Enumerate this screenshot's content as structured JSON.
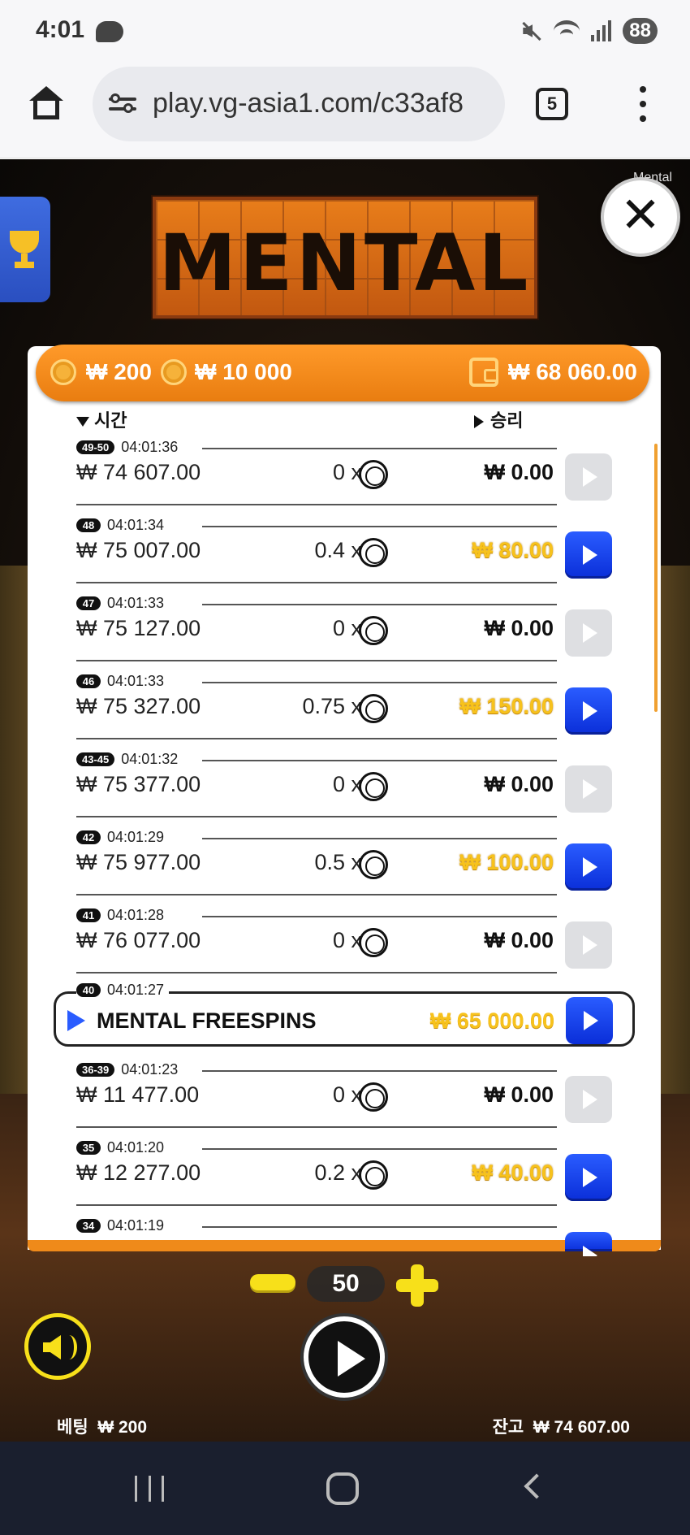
{
  "status_bar": {
    "time": "4:01",
    "battery": "88"
  },
  "browser": {
    "url": "play.vg-asia1.com/c33af8",
    "tab_count": "5"
  },
  "game": {
    "logo_text": "MENTAL",
    "title_label": "Mental",
    "header": {
      "min_bet": "₩ 200",
      "max_bet": "₩ 10 000",
      "wallet": "₩ 68 060.00"
    },
    "columns": {
      "time": "시간",
      "win": "승리"
    },
    "rows": [
      {
        "round": "49-50",
        "time": "04:01:36",
        "amount": "₩ 74 607.00",
        "mult": "0 x",
        "win": "₩ 0.00",
        "win_style": "dark",
        "replay": "inactive"
      },
      {
        "round": "48",
        "time": "04:01:34",
        "amount": "₩ 75 007.00",
        "mult": "0.4 x",
        "win": "₩ 80.00",
        "win_style": "gold",
        "replay": "active"
      },
      {
        "round": "47",
        "time": "04:01:33",
        "amount": "₩ 75 127.00",
        "mult": "0 x",
        "win": "₩ 0.00",
        "win_style": "dark",
        "replay": "inactive"
      },
      {
        "round": "46",
        "time": "04:01:33",
        "amount": "₩ 75 327.00",
        "mult": "0.75 x",
        "win": "₩ 150.00",
        "win_style": "gold",
        "replay": "active"
      },
      {
        "round": "43-45",
        "time": "04:01:32",
        "amount": "₩ 75 377.00",
        "mult": "0 x",
        "win": "₩ 0.00",
        "win_style": "dark",
        "replay": "inactive"
      },
      {
        "round": "42",
        "time": "04:01:29",
        "amount": "₩ 75 977.00",
        "mult": "0.5 x",
        "win": "₩ 100.00",
        "win_style": "gold",
        "replay": "active"
      },
      {
        "round": "41",
        "time": "04:01:28",
        "amount": "₩ 76 077.00",
        "mult": "0 x",
        "win": "₩ 0.00",
        "win_style": "dark",
        "replay": "inactive"
      }
    ],
    "freespins": {
      "round": "40",
      "time": "04:01:27",
      "label": "MENTAL FREESPINS",
      "win": "₩ 65 000.00"
    },
    "rows_after": [
      {
        "round": "36-39",
        "time": "04:01:23",
        "amount": "₩ 11 477.00",
        "mult": "0 x",
        "win": "₩ 0.00",
        "win_style": "dark",
        "replay": "inactive"
      },
      {
        "round": "35",
        "time": "04:01:20",
        "amount": "₩ 12 277.00",
        "mult": "0.2 x",
        "win": "₩ 40.00",
        "win_style": "gold",
        "replay": "active"
      },
      {
        "round": "34",
        "time": "04:01:19"
      }
    ],
    "controls": {
      "bet_value": "50",
      "bet_label": "베팅",
      "bet_amount": "₩ 200",
      "balance_label": "잔고",
      "balance_amount": "₩ 74 607.00"
    }
  }
}
